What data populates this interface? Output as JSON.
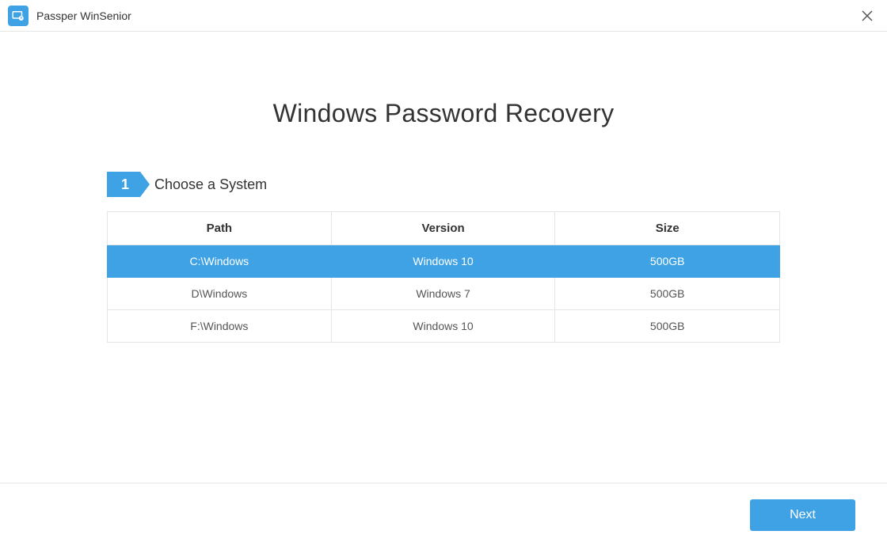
{
  "app": {
    "title": "Passper WinSenior"
  },
  "heading": "Windows Password Recovery",
  "step": {
    "number": "1",
    "label": "Choose a System"
  },
  "table": {
    "headers": {
      "path": "Path",
      "version": "Version",
      "size": "Size"
    },
    "rows": [
      {
        "path": "C:\\Windows",
        "version": "Windows 10",
        "size": "500GB",
        "selected": true
      },
      {
        "path": "D\\Windows",
        "version": "Windows 7",
        "size": "500GB",
        "selected": false
      },
      {
        "path": "F:\\Windows",
        "version": "Windows 10",
        "size": "500GB",
        "selected": false
      }
    ]
  },
  "buttons": {
    "next": "Next"
  }
}
